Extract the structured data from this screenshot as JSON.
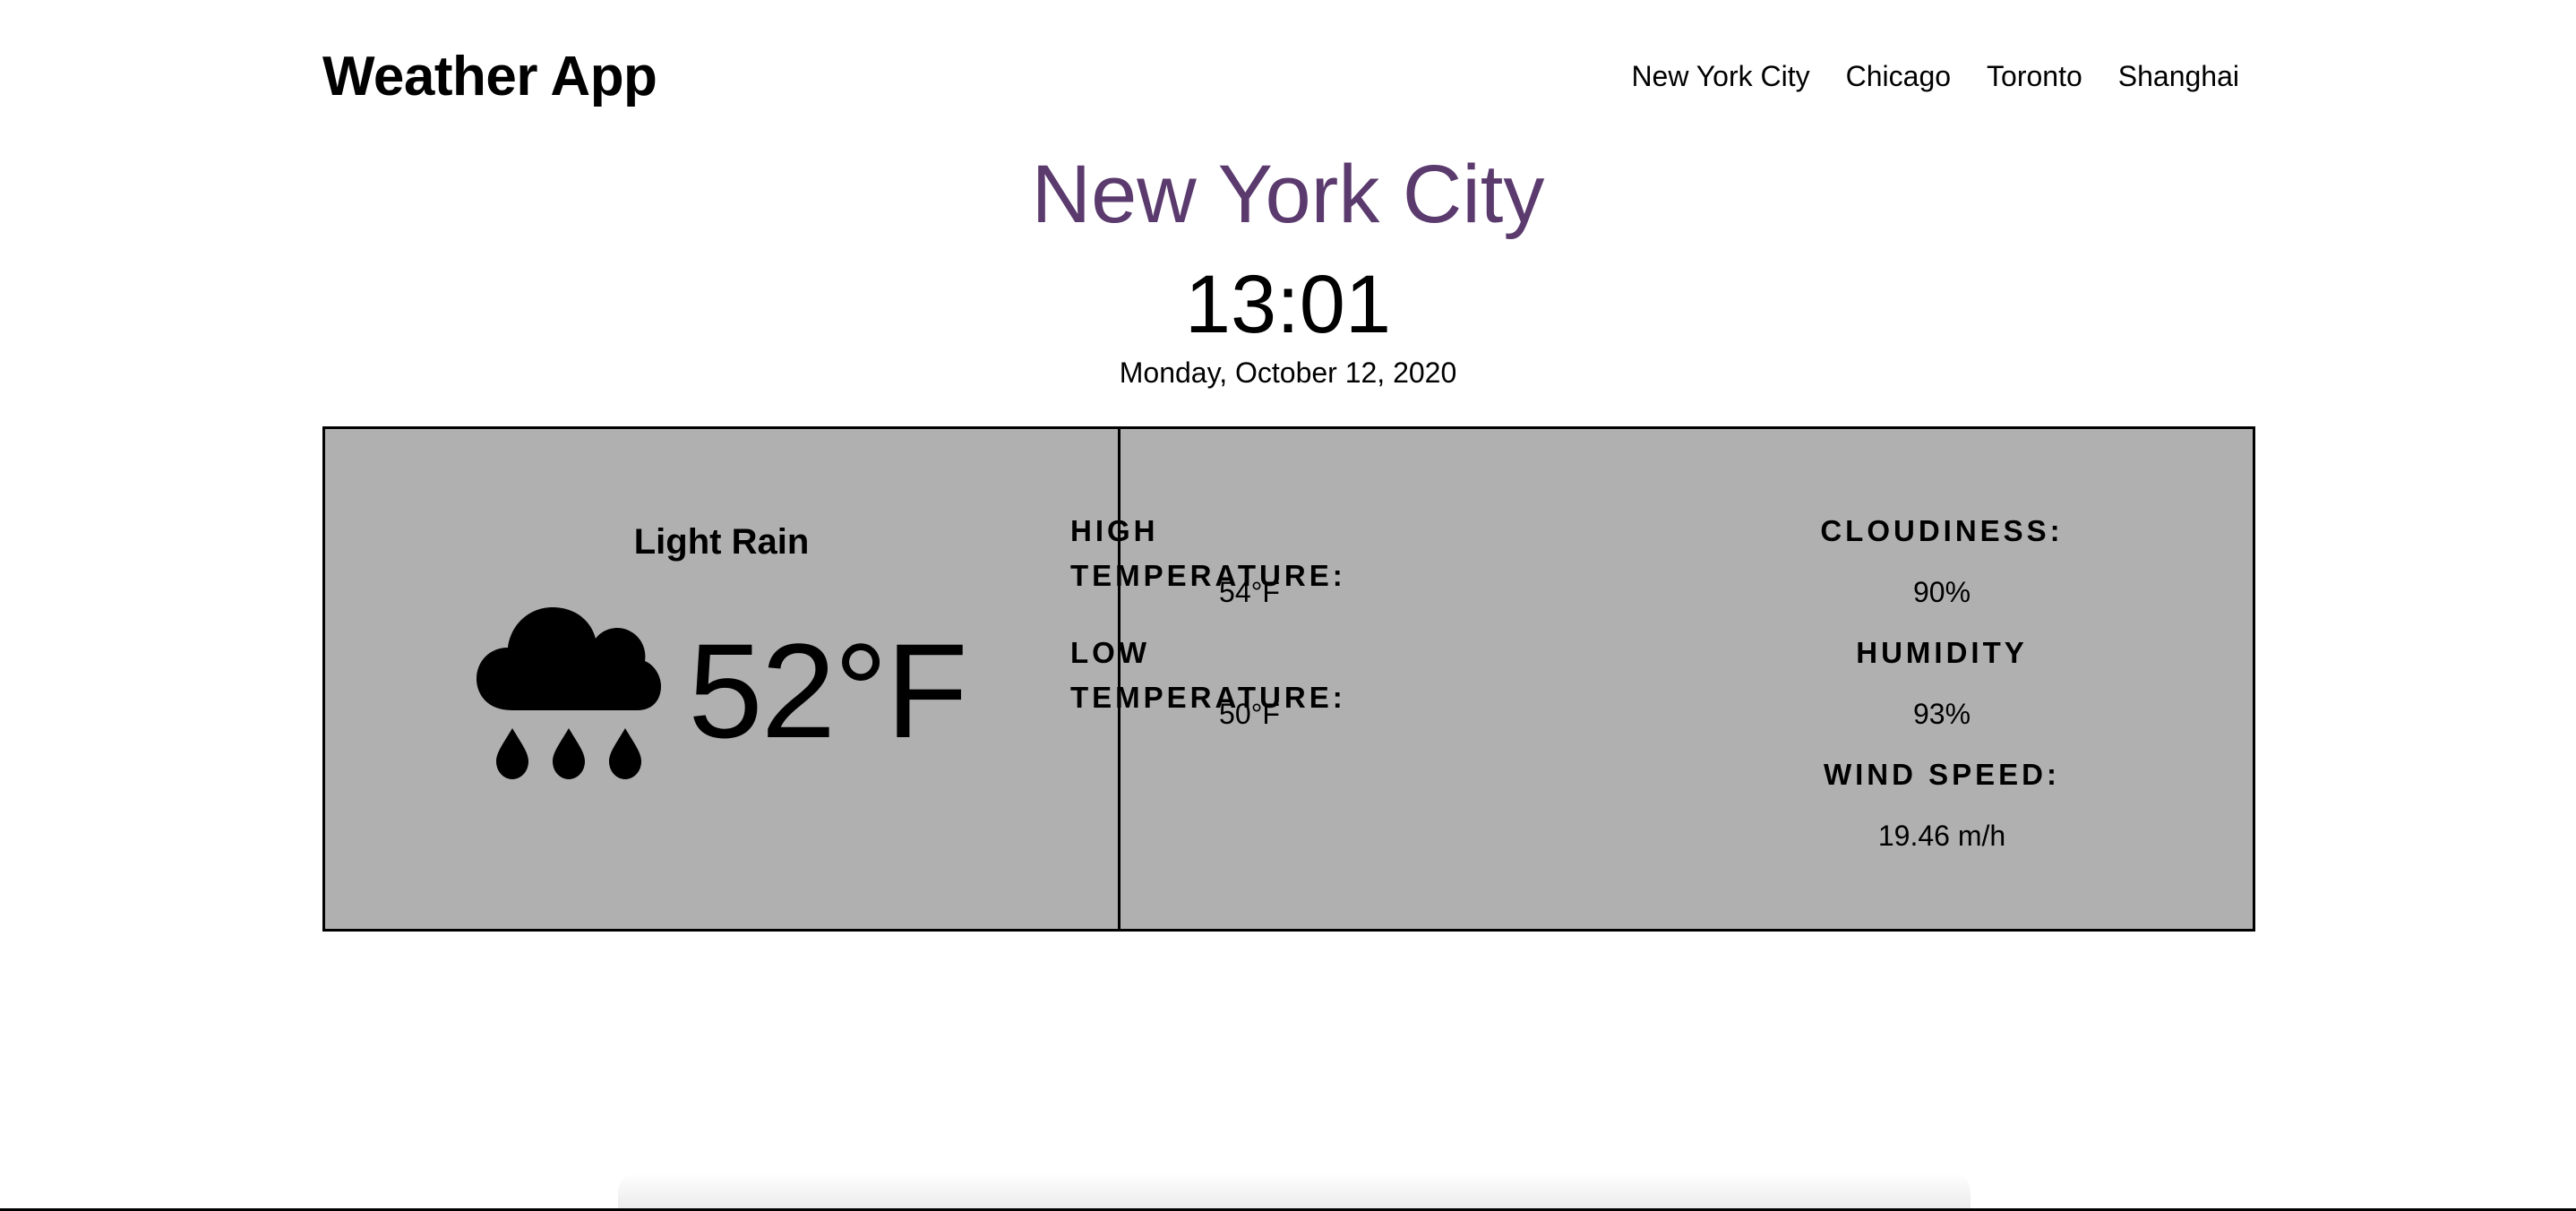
{
  "app": {
    "title": "Weather App"
  },
  "nav": {
    "items": [
      "New York City",
      "Chicago",
      "Toronto",
      "Shanghai"
    ]
  },
  "current": {
    "city": "New York City",
    "time": "13:01",
    "date": "Monday, October 12, 2020",
    "condition": "Light Rain",
    "temperature": "52°F",
    "icon": "rain-cloud-icon"
  },
  "stats": {
    "high_label": "HIGH TEMPERATURE:",
    "high_value": "54°F",
    "low_label": "LOW TEMPERATURE:",
    "low_value": "50°F",
    "cloud_label": "CLOUDINESS:",
    "cloud_value": "90%",
    "humidity_label": "HUMIDITY",
    "humidity_value": "93%",
    "wind_label": "WIND SPEED:",
    "wind_value": "19.46 m/h"
  },
  "colors": {
    "accent": "#5b3a6e",
    "panel": "#b0b0b0"
  }
}
